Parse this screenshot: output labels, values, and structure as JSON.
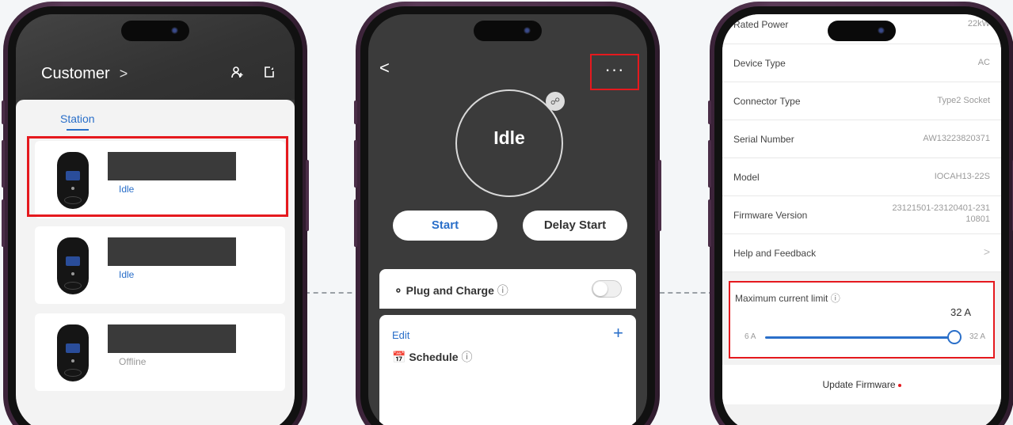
{
  "accent_color": "#2a6fc9",
  "highlight_color": "#e5191e",
  "screen1": {
    "title": "Customer",
    "title_chevron": ">",
    "icon_left": "add-user-icon",
    "icon_right": "export-icon",
    "tab": "Station",
    "stations": [
      {
        "status": "Idle"
      },
      {
        "status": "Idle"
      },
      {
        "status": "Offline"
      }
    ]
  },
  "screen2": {
    "back": "<",
    "more": "···",
    "status": "Idle",
    "start_button": "Start",
    "delay_button": "Delay Start",
    "plug_and_charge": "Plug and Charge",
    "plug_and_charge_enabled": false,
    "edit": "Edit",
    "add": "+",
    "schedule": "Schedule"
  },
  "screen3": {
    "rows": [
      {
        "label": "Rated Power",
        "value": "22kW"
      },
      {
        "label": "Device Type",
        "value": "AC"
      },
      {
        "label": "Connector Type",
        "value": "Type2 Socket"
      },
      {
        "label": "Serial Number",
        "value": "AW13223820371"
      },
      {
        "label": "Model",
        "value": "IOCAH13-22S"
      },
      {
        "label": "Firmware Version",
        "value": "23121501-23120401-231\n10801"
      },
      {
        "label": "Help and Feedback",
        "value": ">"
      }
    ],
    "max_current": {
      "title": "Maximum current limit",
      "value": "32 A",
      "min": "6 A",
      "max": "32 A",
      "level": 1.0
    },
    "update_firmware": "Update Firmware"
  }
}
